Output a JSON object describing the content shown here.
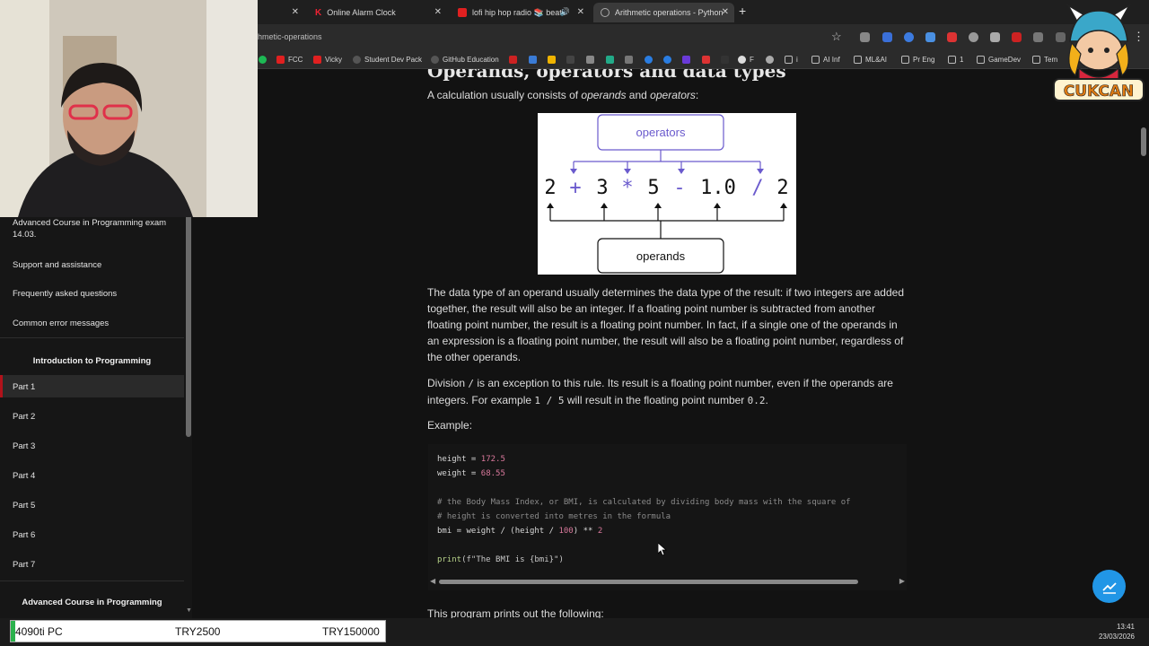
{
  "browser": {
    "tabs": [
      {
        "title": "Online Alarm Clock"
      },
      {
        "title": "lofi hip hop radio 📚 beats"
      },
      {
        "title": "Arithmetic operations - Python"
      }
    ],
    "url": "hmetic-operations",
    "bookmarks": [
      "FCC",
      "Vicky",
      "Student Dev Pack",
      "GitHub Education",
      "F",
      "i",
      "AI Inf",
      "ML&AI",
      "Pr Eng",
      "1",
      "GameDev",
      "Tem"
    ]
  },
  "sidebar": {
    "items_top": [
      "Advanced Course in Programming exam 14.03.",
      "Support and assistance",
      "Frequently asked questions",
      "Common error messages"
    ],
    "section1": "Introduction to Programming",
    "parts": [
      "Part 1",
      "Part 2",
      "Part 3",
      "Part 4",
      "Part 5",
      "Part 6",
      "Part 7"
    ],
    "section2": "Advanced Course in Programming"
  },
  "content": {
    "heading_partial": "Operands, operators and data types",
    "intro": {
      "pre": "A calculation usually consists of ",
      "em1": "operands",
      "mid": " and ",
      "em2": "operators",
      "post": ":"
    },
    "diagram": {
      "operators_label": "operators",
      "operands_label": "operands",
      "tokens": [
        "2",
        "+",
        "3",
        "*",
        "5",
        "-",
        "1.0",
        "/",
        "2"
      ]
    },
    "para1": "The data type of an operand usually determines the data type of the result: if two integers are added together, the result will also be an integer. If a floating point number is subtracted from another floating point number, the result is a floating point number. In fact, if a single one of the operands in an expression is a floating point number, the result will also be a floating point number, regardless of the other operands.",
    "para2": {
      "pre": "Division ",
      "code1": "/",
      "mid": " is an exception to this rule. Its result is a floating point number, even if the operands are integers. For example ",
      "code2": "1 / 5",
      "mid2": " will result in the floating point number ",
      "code3": "0.2",
      "post": "."
    },
    "example_label": "Example:",
    "code": {
      "l1_var": "height = ",
      "l1_num": "172.5",
      "l2_var": "weight = ",
      "l2_num": "68.55",
      "c1": "# the Body Mass Index, or BMI, is calculated by dividing body mass with the square of",
      "c2": "# height is converted into metres in the formula",
      "l5_a": "bmi = weight / (height / ",
      "l5_num": "100",
      "l5_b": ") ** ",
      "l5_num2": "2",
      "l6_fn": "print",
      "l6_rest": "(f\"The BMI is {bmi}\")"
    },
    "para3": "This program prints out the following:"
  },
  "taskbar": {
    "label1": "4090ti PC",
    "label2": "TRY2500",
    "label3": "TRY150000",
    "time": "13:41",
    "date": "23/03/2026"
  },
  "logo_text": "CUKCAN",
  "colors": {
    "accent_red": "#b1121b",
    "diagram_purple": "#6a5acd",
    "fab_blue": "#2196e6",
    "number_pink": "#d8789b"
  }
}
